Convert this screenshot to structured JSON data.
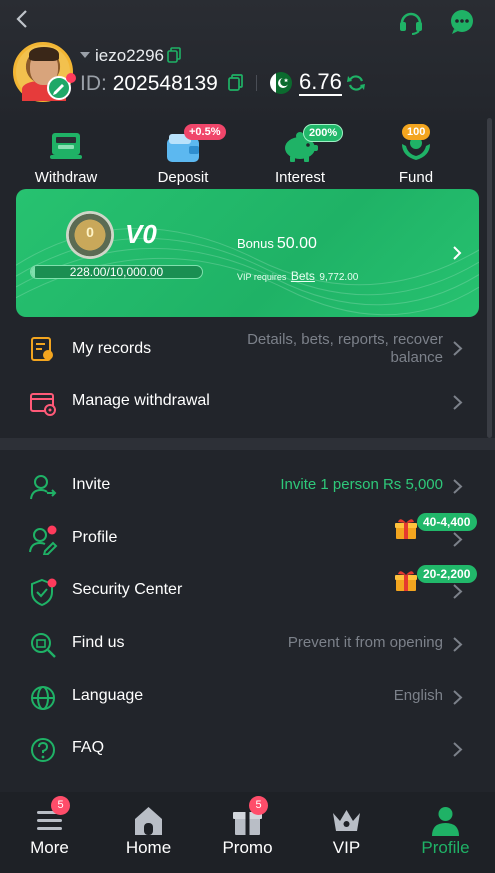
{
  "header": {
    "username": "iezo2296",
    "id_label": "ID:",
    "id_value": "202548139",
    "balance": "6.76"
  },
  "actions": [
    {
      "label": "Withdraw",
      "badge": ""
    },
    {
      "label": "Deposit",
      "badge": "+0.5%"
    },
    {
      "label": "Interest",
      "badge": "200%"
    },
    {
      "label": "Fund",
      "badge": "100"
    }
  ],
  "vip": {
    "medal_level": "0",
    "level": "V0",
    "progress_text": "228.00/10,000.00",
    "progress_fraction": 0.0228,
    "bonus_label": "Bonus",
    "bonus_value": "50.00",
    "req_prefix": "VIP requires",
    "req_link": "Bets",
    "req_value": "9,772.00"
  },
  "records": {
    "label": "My records",
    "desc_line1": "Details, bets, reports, recover",
    "desc_line2": "balance"
  },
  "manage_withdrawal": {
    "label": "Manage withdrawal"
  },
  "menu": {
    "invite": {
      "label": "Invite",
      "desc": "Invite 1 person Rs 5,000"
    },
    "profile": {
      "label": "Profile",
      "reward": "40-4,400"
    },
    "security": {
      "label": "Security Center",
      "reward": "20-2,200"
    },
    "findus": {
      "label": "Find us",
      "desc": "Prevent it from opening"
    },
    "language": {
      "label": "Language",
      "desc": "English"
    },
    "faq": {
      "label": "FAQ"
    }
  },
  "nav": [
    {
      "label": "More",
      "badge": "5"
    },
    {
      "label": "Home",
      "badge": ""
    },
    {
      "label": "Promo",
      "badge": "5"
    },
    {
      "label": "VIP",
      "badge": ""
    },
    {
      "label": "Profile",
      "badge": ""
    }
  ],
  "colors": {
    "accent": "#1fb266",
    "background": "#22252b",
    "badge_red": "#ff4d6a",
    "muted_text": "#7c818a"
  }
}
